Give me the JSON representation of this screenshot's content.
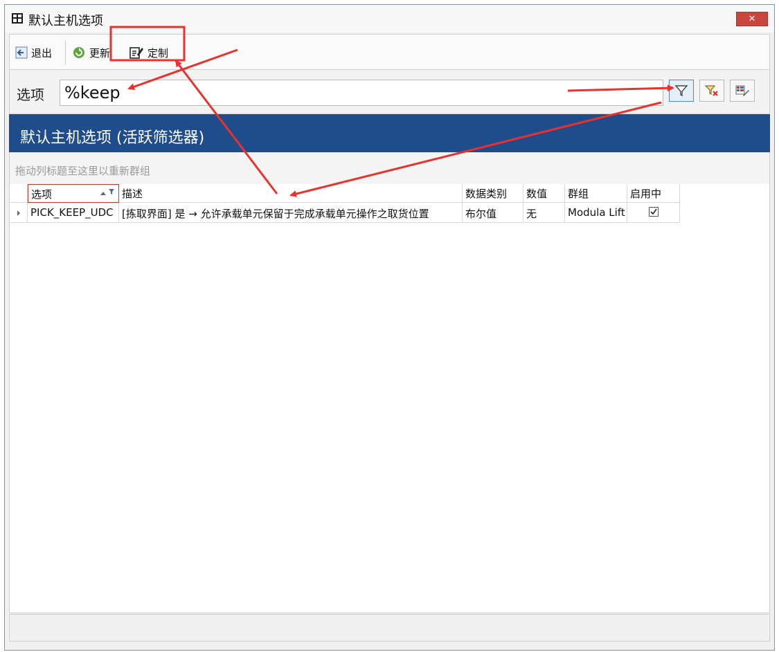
{
  "window": {
    "title": "默认主机选项",
    "close_label": "✕"
  },
  "toolbar": {
    "exit_label": "退出",
    "refresh_label": "更新",
    "customize_label": "定制"
  },
  "filter": {
    "label": "选项",
    "value": "%keep"
  },
  "grid": {
    "header_title": "默认主机选项 (活跃筛选器)",
    "group_hint": "拖动列标题至这里以重新群组",
    "columns": [
      "选项",
      "描述",
      "数据类别",
      "数值",
      "群组",
      "启用中"
    ],
    "rows": [
      {
        "option": "PICK_KEEP_UDC",
        "description": "[拣取界面] 是 → 允许承载单元保留于完成承载单元操作之取货位置",
        "data_type": "布尔值",
        "value": "无",
        "group": "Modula Lift",
        "enabled": true
      }
    ]
  },
  "colors": {
    "header_bg": "#1f4d8c",
    "close_bg": "#c9463d",
    "annotation": "#e8322b"
  }
}
